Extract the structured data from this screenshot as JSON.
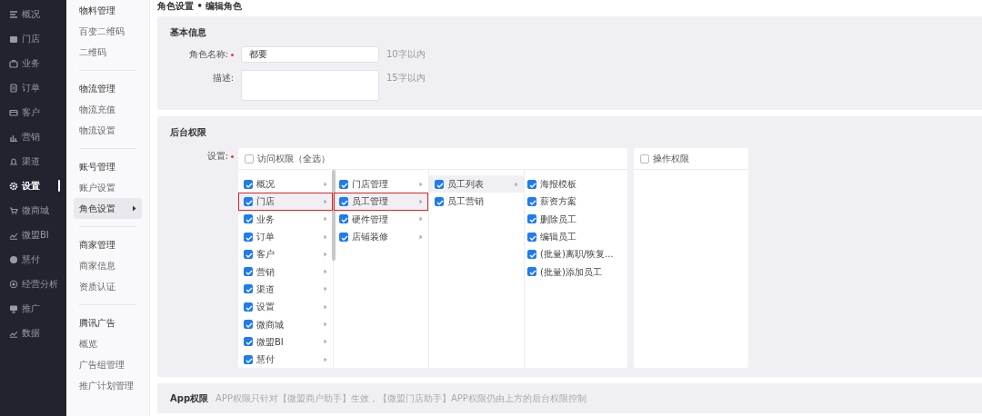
{
  "sidebar": {
    "items": [
      {
        "label": "概况",
        "selected": false
      },
      {
        "label": "门店",
        "selected": false
      },
      {
        "label": "业务",
        "selected": false
      },
      {
        "label": "订单",
        "selected": false
      },
      {
        "label": "客户",
        "selected": false
      },
      {
        "label": "营销",
        "selected": false
      },
      {
        "label": "渠道",
        "selected": false
      },
      {
        "label": "设置",
        "selected": true
      },
      {
        "label": "微商城",
        "selected": false
      },
      {
        "label": "微盟BI",
        "selected": false
      },
      {
        "label": "慧付",
        "selected": false
      },
      {
        "label": "经营分析",
        "selected": false
      },
      {
        "label": "推广",
        "selected": false
      },
      {
        "label": "数据",
        "selected": false
      }
    ]
  },
  "submenu": {
    "groups": [
      {
        "title": "物料管理",
        "items": [
          {
            "label": "百变二维码",
            "selected": false
          },
          {
            "label": "二维码",
            "selected": false
          }
        ]
      },
      {
        "title": "物流管理",
        "items": [
          {
            "label": "物流充值",
            "selected": false
          },
          {
            "label": "物流设置",
            "selected": false
          }
        ]
      },
      {
        "title": "账号管理",
        "items": [
          {
            "label": "账户设置",
            "selected": false
          },
          {
            "label": "角色设置",
            "selected": true
          }
        ]
      },
      {
        "title": "商家管理",
        "items": [
          {
            "label": "商家信息",
            "selected": false
          },
          {
            "label": "资质认证",
            "selected": false
          }
        ]
      },
      {
        "title": "腾讯广告",
        "items": [
          {
            "label": "概览",
            "selected": false
          },
          {
            "label": "广告组管理",
            "selected": false
          },
          {
            "label": "推广计划管理",
            "selected": false
          }
        ]
      }
    ]
  },
  "breadcrumb": "角色设置 • 编辑角色",
  "basic_info": {
    "title": "基本信息",
    "fields": [
      {
        "kind": "input",
        "label": "角色名称:",
        "required": true,
        "value": "都要",
        "hint": "10字以内"
      },
      {
        "kind": "textarea",
        "label": "描述:",
        "required": false,
        "hint": "15字以内"
      }
    ]
  },
  "backend_permissions": {
    "title": "后台权限",
    "label": "设置:",
    "required": true,
    "access": {
      "label": "访问权限（全选）",
      "checked": false
    },
    "columns": [
      [
        {
          "label": "概况",
          "checked": true,
          "selected": false,
          "annotated": false,
          "has_children": true
        },
        {
          "label": "门店",
          "checked": true,
          "selected": true,
          "annotated": true,
          "has_children": true
        },
        {
          "label": "业务",
          "checked": true,
          "selected": false,
          "annotated": false,
          "has_children": true
        },
        {
          "label": "订单",
          "checked": true,
          "selected": false,
          "annotated": false,
          "has_children": true
        },
        {
          "label": "客户",
          "checked": true,
          "selected": false,
          "annotated": false,
          "has_children": true
        },
        {
          "label": "营销",
          "checked": true,
          "selected": false,
          "annotated": false,
          "has_children": true
        },
        {
          "label": "渠道",
          "checked": true,
          "selected": false,
          "annotated": false,
          "has_children": true
        },
        {
          "label": "设置",
          "checked": true,
          "selected": false,
          "annotated": false,
          "has_children": true
        },
        {
          "label": "微商城",
          "checked": true,
          "selected": false,
          "annotated": false,
          "has_children": true
        },
        {
          "label": "微盟BI",
          "checked": true,
          "selected": false,
          "annotated": false,
          "has_children": true
        },
        {
          "label": "慧付",
          "checked": true,
          "selected": false,
          "annotated": false,
          "has_children": true
        }
      ],
      [
        {
          "label": "门店管理",
          "checked": true,
          "selected": false,
          "annotated": false,
          "has_children": true
        },
        {
          "label": "员工管理",
          "checked": true,
          "selected": true,
          "annotated": true,
          "has_children": true
        },
        {
          "label": "硬件管理",
          "checked": true,
          "selected": false,
          "annotated": false,
          "has_children": true
        },
        {
          "label": "店铺装修",
          "checked": true,
          "selected": false,
          "annotated": false,
          "has_children": true
        }
      ],
      [
        {
          "label": "员工列表",
          "checked": true,
          "selected": true,
          "annotated": false,
          "has_children": true
        },
        {
          "label": "员工营销",
          "checked": true,
          "selected": false,
          "annotated": false,
          "has_children": false
        }
      ],
      [
        {
          "label": "海报模板",
          "checked": true,
          "selected": false,
          "annotated": false,
          "has_children": false
        },
        {
          "label": "薪资方案",
          "checked": true,
          "selected": false,
          "annotated": false,
          "has_children": false
        },
        {
          "label": "删除员工",
          "checked": true,
          "selected": false,
          "annotated": false,
          "has_children": false
        },
        {
          "label": "编辑员工",
          "checked": true,
          "selected": false,
          "annotated": false,
          "has_children": false
        },
        {
          "label": "(批量)离职/恢复...",
          "checked": true,
          "selected": false,
          "annotated": false,
          "has_children": false
        },
        {
          "label": "(批量)添加员工",
          "checked": true,
          "selected": false,
          "annotated": false,
          "has_children": false
        }
      ]
    ],
    "operations": {
      "label": "操作权限",
      "checked": false
    }
  },
  "app_permissions": {
    "title": "App权限",
    "note": "APP权限只针对【微盟商户助手】生效，【微盟门店助手】APP权限仍由上方的后台权限控制"
  }
}
